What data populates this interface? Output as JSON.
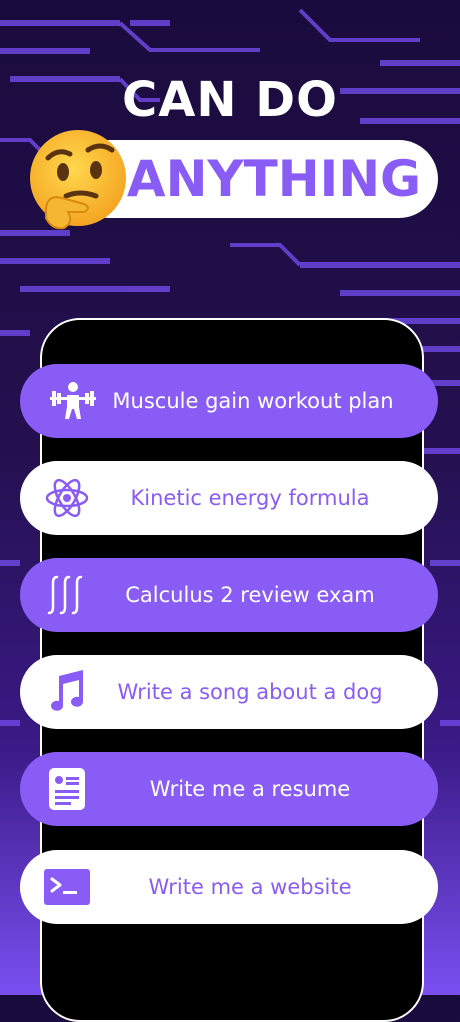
{
  "headline": {
    "line1": "CAN DO",
    "line2": "ANYTHING"
  },
  "emoji": "thinking-face",
  "colors": {
    "accent": "#8a5cf6",
    "background_dark": "#1a0b3d",
    "card_white": "#ffffff"
  },
  "prompts": [
    {
      "label": "Muscule gain workout plan",
      "icon": "weightlifting-icon",
      "style": "purple"
    },
    {
      "label": "Kinetic energy formula",
      "icon": "atom-icon",
      "style": "white"
    },
    {
      "label": "Calculus 2 review exam",
      "icon": "integral-icon",
      "style": "purple"
    },
    {
      "label": "Write a song about a dog",
      "icon": "music-note-icon",
      "style": "white"
    },
    {
      "label": "Write me a resume",
      "icon": "resume-icon",
      "style": "purple"
    },
    {
      "label": "Write me a website",
      "icon": "terminal-icon",
      "style": "white"
    }
  ]
}
